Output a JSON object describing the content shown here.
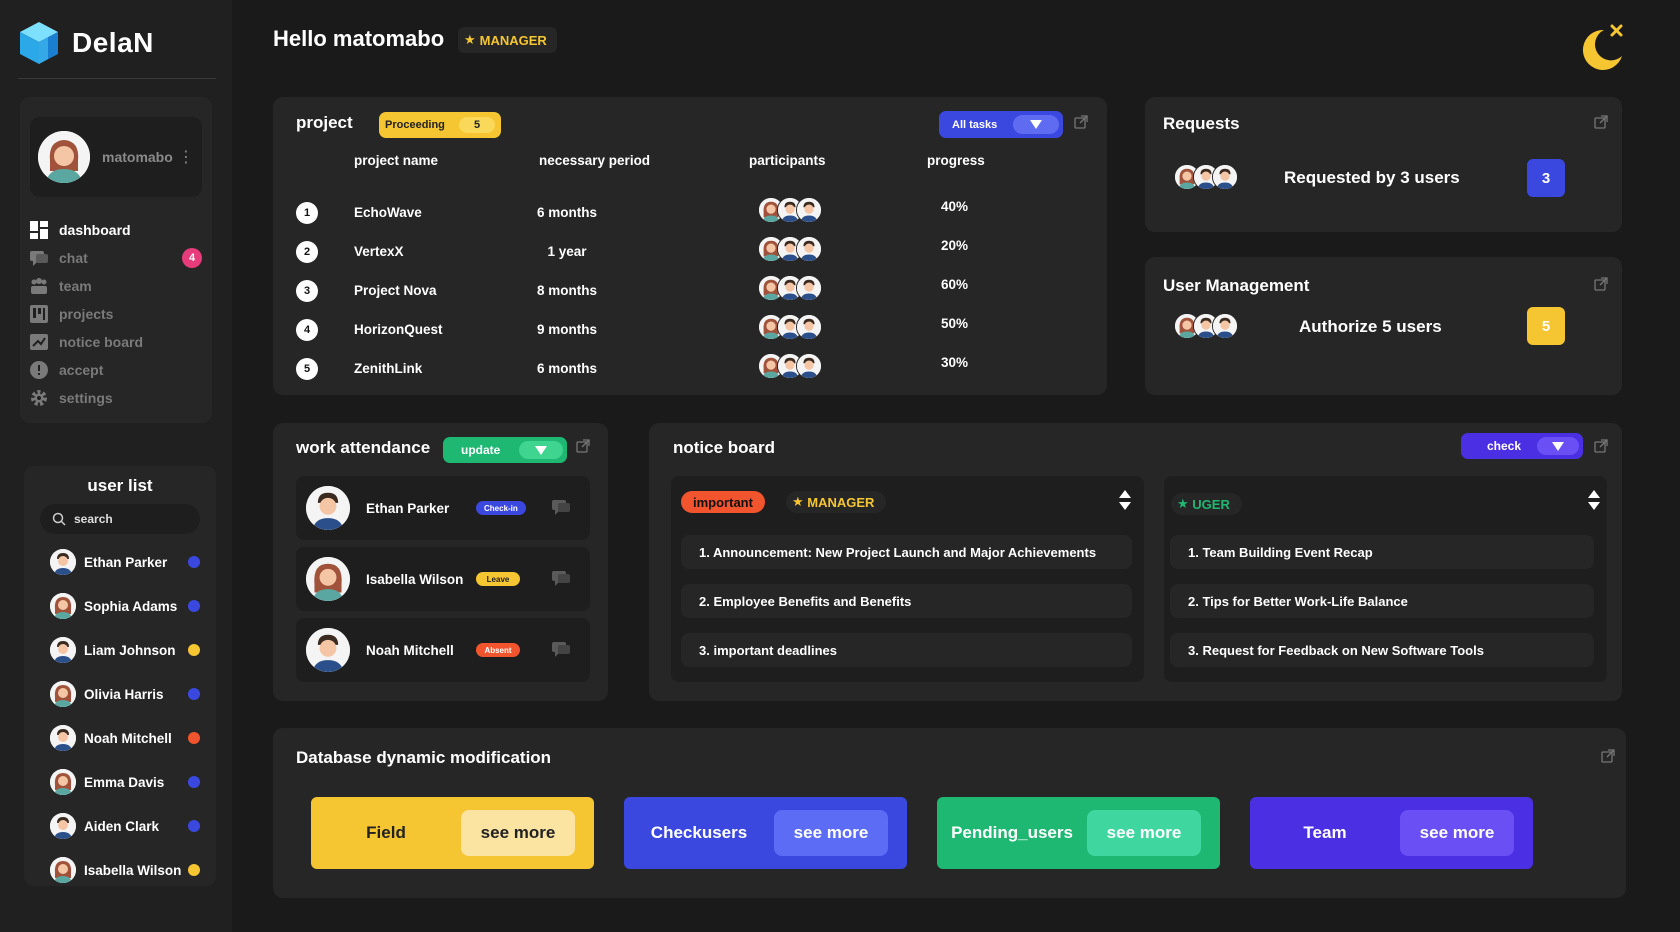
{
  "app": {
    "name": "DelaN"
  },
  "profile": {
    "name": "matomabo"
  },
  "nav": [
    {
      "label": "dashboard",
      "icon": "dashboard-icon",
      "active": true
    },
    {
      "label": "chat",
      "icon": "chat-icon",
      "badge": "4"
    },
    {
      "label": "team",
      "icon": "team-icon"
    },
    {
      "label": "projects",
      "icon": "projects-icon"
    },
    {
      "label": "notice board",
      "icon": "notice-board-icon"
    },
    {
      "label": "accept",
      "icon": "accept-icon"
    },
    {
      "label": "settings",
      "icon": "settings-icon"
    }
  ],
  "userlist": {
    "title": "user list",
    "search_placeholder": "search",
    "users": [
      {
        "name": "Ethan Parker",
        "status_color": "#3b48e0"
      },
      {
        "name": "Sophia Adams",
        "status_color": "#3b48e0"
      },
      {
        "name": "Liam Johnson",
        "status_color": "#f5c532"
      },
      {
        "name": "Olivia Harris",
        "status_color": "#3b48e0"
      },
      {
        "name": "Noah Mitchell",
        "status_color": "#f2542d"
      },
      {
        "name": "Emma Davis",
        "status_color": "#3b48e0"
      },
      {
        "name": "Aiden Clark",
        "status_color": "#3b48e0"
      },
      {
        "name": "Isabella Wilson",
        "status_color": "#f5c532"
      }
    ]
  },
  "header": {
    "greeting": "Hello matomabo",
    "role": "MANAGER"
  },
  "project": {
    "title": "project",
    "filter_label": "Proceeding",
    "filter_count": "5",
    "tasks_dropdown": "All tasks",
    "columns": [
      "project name",
      "necessary period",
      "participants",
      "progress"
    ],
    "rows": [
      {
        "num": "1",
        "name": "EchoWave",
        "period": "6 months",
        "progress": "40%"
      },
      {
        "num": "2",
        "name": "VertexX",
        "period": "1 year",
        "progress": "20%"
      },
      {
        "num": "3",
        "name": "Project Nova",
        "period": "8 months",
        "progress": "60%"
      },
      {
        "num": "4",
        "name": "HorizonQuest",
        "period": "9 months",
        "progress": "50%"
      },
      {
        "num": "5",
        "name": "ZenithLink",
        "period": "6 months",
        "progress": "30%"
      }
    ]
  },
  "requests": {
    "title": "Requests",
    "text": "Requested by 3 users",
    "count": "3"
  },
  "user_management": {
    "title": "User Management",
    "text": "Authorize 5 users",
    "count": "5"
  },
  "attendance": {
    "title": "work attendance",
    "dropdown": "update",
    "rows": [
      {
        "name": "Ethan Parker",
        "status": "Check-in",
        "status_color": "#3b48e0"
      },
      {
        "name": "Isabella Wilson",
        "status": "Leave",
        "status_color": "#f5c532"
      },
      {
        "name": "Noah Mitchell",
        "status": "Absent",
        "status_color": "#f2542d"
      }
    ]
  },
  "notice_board": {
    "title": "notice board",
    "dropdown": "check",
    "left": {
      "tag": "important",
      "role": "MANAGER",
      "items": [
        "1. Announcement: New Project Launch and Major Achievements",
        "2. Employee Benefits and Benefits",
        "3. important deadlines"
      ]
    },
    "right": {
      "role": "UGER",
      "items": [
        "1. Team Building Event Recap",
        "2. Tips for Better Work-Life Balance",
        "3. Request for Feedback on New Software Tools"
      ]
    }
  },
  "database": {
    "title": "Database dynamic modification",
    "tiles": [
      {
        "label": "Field",
        "action": "see more",
        "color": "#f5c532",
        "btn_color": "#fbe3a2"
      },
      {
        "label": "Checkusers",
        "action": "see more",
        "color": "#3b48e0",
        "btn_color": "#5c6cf5"
      },
      {
        "label": "Pending_users",
        "action": "see more",
        "color": "#1fb873",
        "btn_color": "#3fd6a0"
      },
      {
        "label": "Team",
        "action": "see more",
        "color": "#4b2fe2",
        "btn_color": "#6a4ff5"
      }
    ]
  },
  "colors": {
    "accent_blue": "#3b48e0",
    "accent_yellow": "#f5c532",
    "accent_green": "#1fb873",
    "accent_purple": "#4b2fe2",
    "accent_red": "#f2542d",
    "badge_pink": "#e83b7b"
  }
}
